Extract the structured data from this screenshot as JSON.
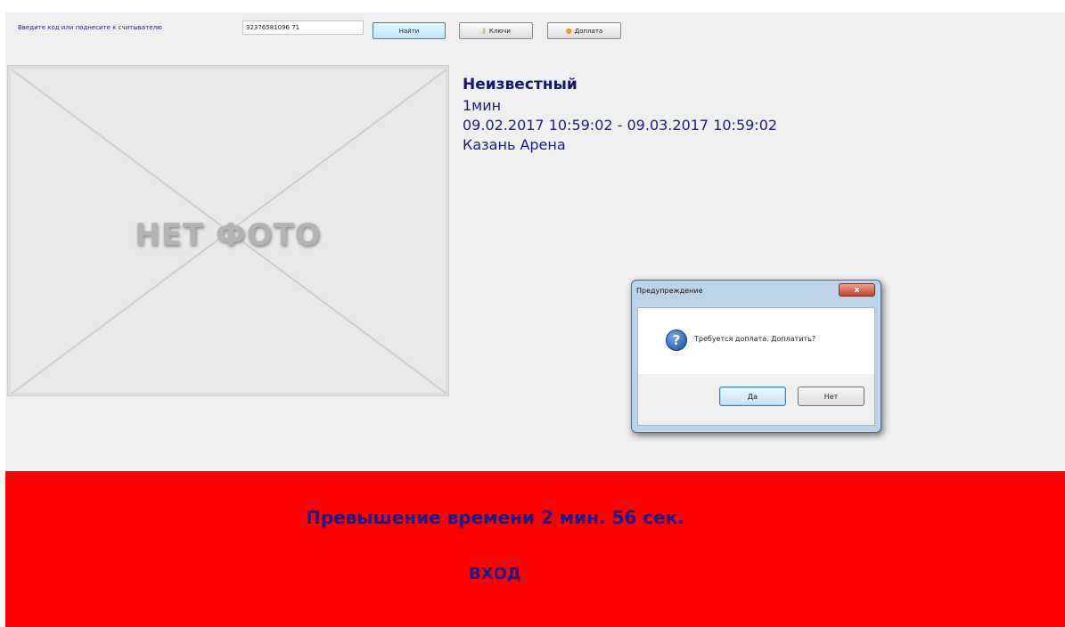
{
  "toolbar": {
    "prompt_label": "Введите код или поднесите к считывателю",
    "code_value": "32376581096 71",
    "find_label": "Найти",
    "keys_label": "Ключи",
    "keys_icon": "key-icon",
    "payment_label": "Доплата",
    "payment_icon": "coins-icon"
  },
  "photo": {
    "placeholder_text": "НЕТ ФОТО"
  },
  "visitor": {
    "name": "Неизвестный",
    "duration": "1мин",
    "validity": "09.02.2017 10:59:02 - 09.03.2017 10:59:02",
    "location": "Казань Арена"
  },
  "dialog": {
    "title": "Предупреждение",
    "close_symbol": "x",
    "icon": "question-icon",
    "message": "Требуется доплата. Доплатить?",
    "yes_label": "Да",
    "no_label": "Нет"
  },
  "status": {
    "overtime_text": "Превышение времени 2 мин. 56 сек.",
    "direction_text": "ВХОД",
    "background_color": "#ff0000",
    "text_color": "#1a1a8a"
  }
}
